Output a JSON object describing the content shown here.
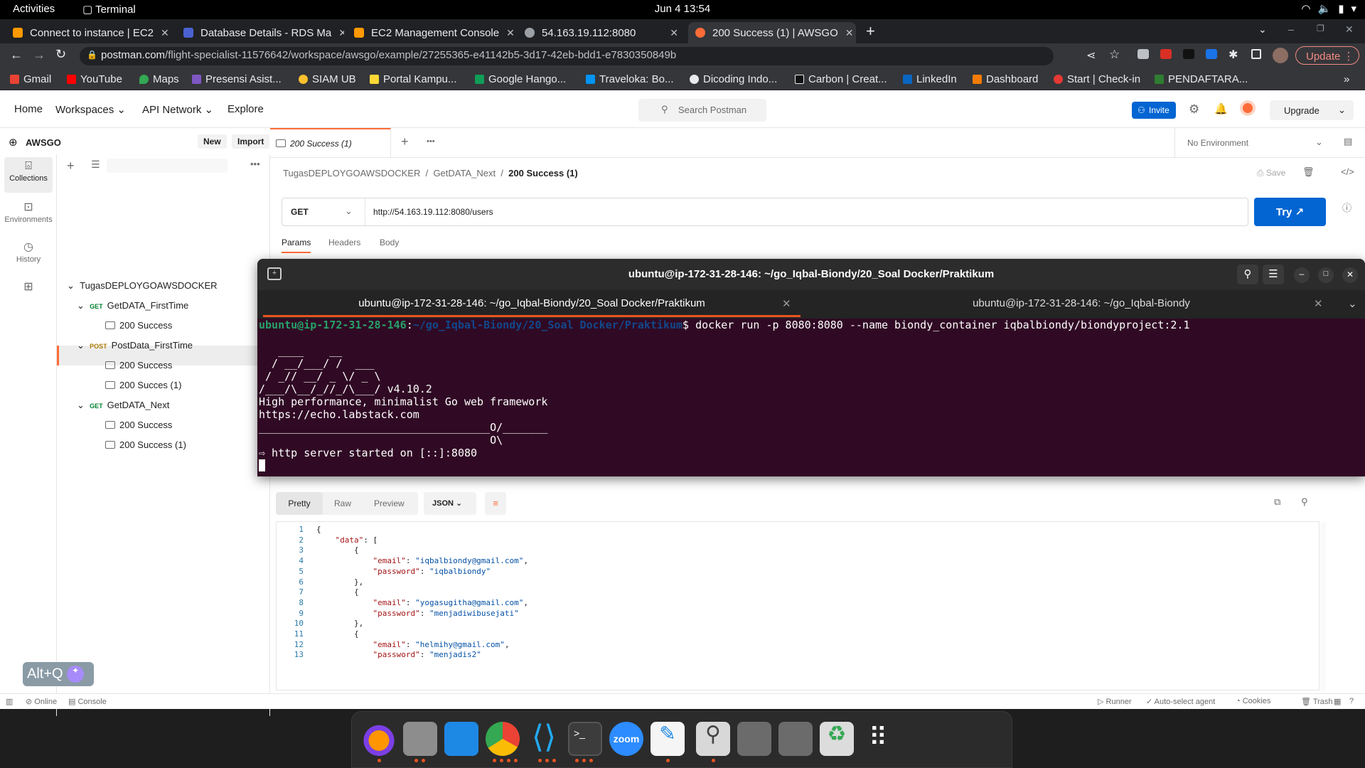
{
  "topbar": {
    "activities": "Activities",
    "app": "Terminal",
    "clock": "Jun 4  13:54"
  },
  "browser": {
    "tabs": [
      {
        "title": "Connect to instance | EC2",
        "color": "#ff9900"
      },
      {
        "title": "Database Details - RDS Ma",
        "color": "#4b61d1"
      },
      {
        "title": "EC2 Management Console",
        "color": "#ff9900"
      },
      {
        "title": "54.163.19.112:8080",
        "color": "#9aa0a6"
      },
      {
        "title": "200 Success (1) | AWSGO",
        "color": "#ff6c37"
      }
    ],
    "url_host": "postman.com",
    "url_path": "/flight-specialist-11576642/workspace/awsgo/example/27255365-e41142b5-3d17-42eb-bdd1-e7830350849b",
    "update_label": "Update",
    "bookmarks": [
      "Gmail",
      "YouTube",
      "Maps",
      "Presensi Asist...",
      "SIAM UB",
      "Portal Kampu...",
      "Google Hango...",
      "Traveloka: Bo...",
      "Dicoding Indo...",
      "Carbon | Creat...",
      "LinkedIn",
      "Dashboard",
      "Start | Check-in",
      "PENDAFTARA..."
    ]
  },
  "postman": {
    "nav": [
      "Home",
      "Workspaces",
      "API Network",
      "Explore"
    ],
    "search": "Search Postman",
    "invite": "Invite",
    "upgrade": "Upgrade",
    "workspace": "AWSGO",
    "new": "New",
    "import": "Import",
    "rail": [
      "Collections",
      "Environments",
      "History"
    ],
    "tree": {
      "collection": "TugasDEPLOYGOAWSDOCKER",
      "items": [
        {
          "method": "GET",
          "name": "GetDATA_FirstTime",
          "examples": [
            "200 Success"
          ]
        },
        {
          "method": "POST",
          "name": "PostData_FirstTime",
          "examples": [
            "200 Success",
            "200 Succes (1)"
          ]
        },
        {
          "method": "GET",
          "name": "GetDATA_Next",
          "examples": [
            "200 Success",
            "200 Success (1)"
          ]
        }
      ]
    },
    "open_tab": "200 Success (1)",
    "environment": "No Environment",
    "breadcrumb": [
      "TugasDEPLOYGOAWSDOCKER",
      "GetDATA_Next",
      "200 Success (1)"
    ],
    "save": "Save",
    "method": "GET",
    "request_url": "http://54.163.19.112:8080/users",
    "try": "Try ↗",
    "req_tabs": [
      "Params",
      "Headers",
      "Body"
    ],
    "resp_views": [
      "Pretty",
      "Raw",
      "Preview"
    ],
    "format": "JSON",
    "status_bar": [
      "Online",
      "Console",
      "Runner",
      "Auto-select agent",
      "Cookies",
      "Trash"
    ],
    "code_lines": [
      "{",
      "    \"data\": [",
      "        {",
      "            \"email\": \"iqbalbiondy@gmail.com\",",
      "            \"password\": \"iqbalbiondy\"",
      "        },",
      "        {",
      "            \"email\": \"yogasugitha@gmail.com\",",
      "            \"password\": \"menjadiwibusejati\"",
      "        },",
      "        {",
      "            \"email\": \"helmihy@gmail.com\",",
      "            \"password\": \"menjadis2\""
    ]
  },
  "terminal": {
    "title": "ubuntu@ip-172-31-28-146: ~/go_Iqbal-Biondy/20_Soal Docker/Praktikum",
    "tabs": [
      "ubuntu@ip-172-31-28-146: ~/go_Iqbal-Biondy/20_Soal Docker/Praktikum",
      "ubuntu@ip-172-31-28-146: ~/go_Iqbal-Biondy"
    ],
    "prompt_user": "ubuntu@ip-172-31-28-146",
    "prompt_path": "~/go_Iqbal-Biondy/20_Soal Docker/Praktikum",
    "command": "$ docker run -p 8080:8080 --name biondy_container iqbalbiondy/biondyproject:2.1",
    "output": [
      "",
      "   ____    __",
      "  / __/___/ /  ___",
      " / _// __/ _ \\/ _ \\",
      "/___/\\__/_//_/\\___/ v4.10.2",
      "High performance, minimalist Go web framework",
      "https://echo.labstack.com",
      "____________________________________O/_______",
      "                                    O\\",
      "⇨ http server started on [::]:8080"
    ]
  },
  "altq": "Alt+Q"
}
